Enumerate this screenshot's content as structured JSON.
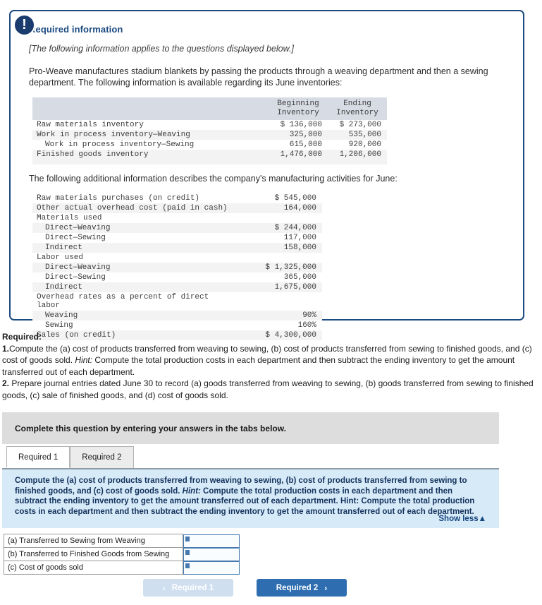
{
  "alert": {
    "icon": "exclamation-icon",
    "glyph": "!"
  },
  "info_card": {
    "title": "Required information",
    "bracket_note": "[The following information applies to the questions displayed below.]",
    "intro": "Pro-Weave manufactures stadium blankets by passing the products through a weaving department and then a sewing department. The following information is available regarding its June inventories:",
    "mid_text": "The following additional information describes the company's manufacturing activities for June:",
    "inventory_table": {
      "headers": [
        "",
        "Beginning Inventory",
        "Ending Inventory"
      ],
      "header_line1": [
        "Beginning",
        "Ending"
      ],
      "header_line2": [
        "Inventory",
        "Inventory"
      ],
      "rows": [
        {
          "label": "Raw materials inventory",
          "indent": 0,
          "beginning": "$ 136,000",
          "ending": "$ 273,000"
        },
        {
          "label": "Work in process inventory—Weaving",
          "indent": 0,
          "beginning": "325,000",
          "ending": "535,000"
        },
        {
          "label": "Work in process inventory—Sewing",
          "indent": 1,
          "beginning": "615,000",
          "ending": "920,000"
        },
        {
          "label": "Finished goods inventory",
          "indent": 0,
          "beginning": "1,476,000",
          "ending": "1,206,000"
        }
      ]
    },
    "activity_table": {
      "rows": [
        {
          "label": "Raw materials purchases (on credit)",
          "indent": 0,
          "value": "$ 545,000"
        },
        {
          "label": "Other actual overhead cost (paid in cash)",
          "indent": 0,
          "value": "164,000"
        },
        {
          "label": "Materials used",
          "indent": 0,
          "value": ""
        },
        {
          "label": "Direct—Weaving",
          "indent": 1,
          "value": "$ 244,000"
        },
        {
          "label": "Direct—Sewing",
          "indent": 1,
          "value": "117,000"
        },
        {
          "label": "Indirect",
          "indent": 1,
          "value": "158,000"
        },
        {
          "label": "Labor used",
          "indent": 0,
          "value": ""
        },
        {
          "label": "Direct—Weaving",
          "indent": 1,
          "value": "$ 1,325,000"
        },
        {
          "label": "Direct—Sewing",
          "indent": 1,
          "value": "365,000"
        },
        {
          "label": "Indirect",
          "indent": 1,
          "value": "1,675,000"
        },
        {
          "label": "Overhead rates as a percent of direct labor",
          "indent": 0,
          "value": ""
        },
        {
          "label": "Weaving",
          "indent": 1,
          "value": "90%"
        },
        {
          "label": "Sewing",
          "indent": 1,
          "value": "160%"
        },
        {
          "label": "Sales (on credit)",
          "indent": 0,
          "value": "$ 4,300,000"
        }
      ]
    }
  },
  "required": {
    "heading": "Required:",
    "item1_lead": "1.",
    "item1_a": "Compute the (a) cost of products transferred from weaving to sewing, (b) cost of products transferred from sewing to finished goods, and (c) cost of goods sold. ",
    "item1_hint": "Hint:",
    "item1_b": " Compute the total production costs in each department and then subtract the ending inventory to get the amount transferred out of each department.",
    "item2_lead": "2.",
    "item2_text": " Prepare journal entries dated June 30 to record (a) goods transferred from weaving to sewing, (b) goods transferred from sewing to finished goods, (c) sale of finished goods, and (d) cost of goods sold."
  },
  "grey_bar": {
    "text": "Complete this question by entering your answers in the tabs below."
  },
  "tabs": [
    {
      "label": "Required 1",
      "active": true
    },
    {
      "label": "Required 2",
      "active": false
    }
  ],
  "blue_panel": {
    "text_a": "Compute the (a) cost of products transferred from weaving to sewing, (b) cost of products transferred from sewing to finished goods, and (c) cost of goods sold. ",
    "hint": "Hint:",
    "text_b": " Compute the total production costs in each department and then subtract the ending inventory to get the amount transferred out of each department. Hint: Compute the total production costs in each department and then subtract the ending inventory to get the amount transferred out of each department.",
    "show_less": "Show less▲"
  },
  "answers": {
    "rows": [
      {
        "label": "(a) Transferred to Sewing from Weaving",
        "value": ""
      },
      {
        "label": "(b) Transferred to Finished Goods from Sewing",
        "value": ""
      },
      {
        "label": "(c) Cost of goods sold",
        "value": ""
      }
    ]
  },
  "nav": {
    "prev_label": "Required 1",
    "next_label": "Required 2",
    "prev_chevron": "‹",
    "next_chevron": "›"
  },
  "colors": {
    "card_border": "#1b4a80",
    "title_blue": "#1b4a80",
    "badge_navy": "#1b3c6e",
    "panel_blue": "#d6eaf8",
    "grey_bar": "#dddddd",
    "next_btn": "#2e6eb0",
    "prev_btn": "#cfdff0",
    "table_header": "#d6dbe4"
  }
}
